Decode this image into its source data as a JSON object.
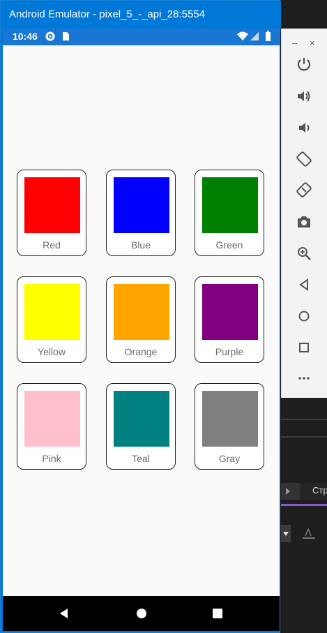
{
  "window": {
    "title": "Android Emulator - pixel_5_-_api_28:5554"
  },
  "status_bar": {
    "time": "10:46"
  },
  "toolbar": {
    "minimize": "–",
    "close": "×"
  },
  "colors": [
    {
      "label": "Red",
      "hex": "#ff0000"
    },
    {
      "label": "Blue",
      "hex": "#0000ff"
    },
    {
      "label": "Green",
      "hex": "#008000"
    },
    {
      "label": "Yellow",
      "hex": "#ffff00"
    },
    {
      "label": "Orange",
      "hex": "#ffa500"
    },
    {
      "label": "Purple",
      "hex": "#800080"
    },
    {
      "label": "Pink",
      "hex": "#ffc0cb"
    },
    {
      "label": "Teal",
      "hex": "#008080"
    },
    {
      "label": "Gray",
      "hex": "#808080"
    }
  ],
  "ide": {
    "tab_label": "Стр"
  }
}
